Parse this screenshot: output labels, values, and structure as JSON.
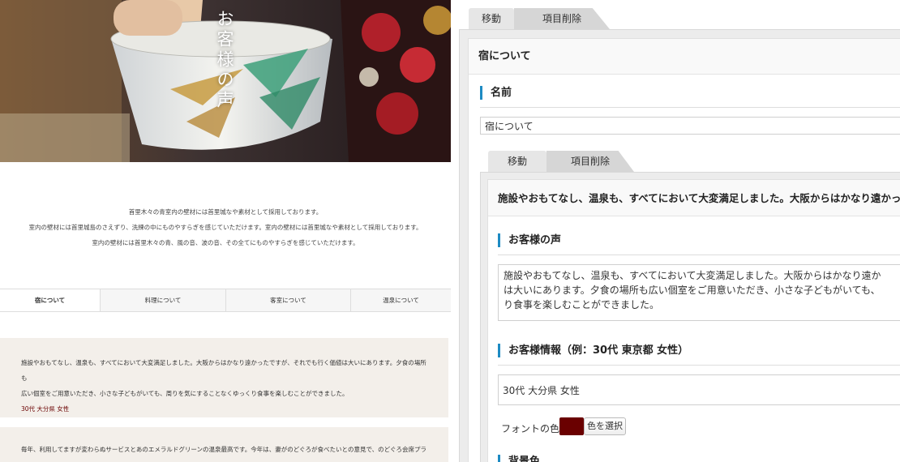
{
  "preview": {
    "hero": {
      "title": "お客様の声"
    },
    "intro": {
      "lines": [
        "首里木々の青室内の壁材には首里城なや素材として採用しております。",
        "室内の壁材には首里城島のさえずり、洗練の中にものやすらぎを感じていただけます。室内の壁材には首里城なや素材として採用しております。",
        "室内の壁材には首里木々の青、風の音、波の音、その全てにものやすらぎを感じていただけます。"
      ]
    },
    "tabs": [
      "宿について",
      "料理について",
      "客室について",
      "温泉について"
    ],
    "reviews": [
      {
        "lines": [
          "施設やおもてなし、温泉も、すべてにおいて大変満足しました。大阪からはかなり遠かったですが、それでも行く価値は大いにあります。夕食の場所も",
          "広い個室をご用意いただき、小さな子どもがいても、周りを気にすることなくゆっくり食事を楽しむことができました。"
        ],
        "meta": "30代 大分県 女性"
      },
      {
        "lines": [
          "毎年、利用してますが変わらぬサービスとあのエメラルドグリーンの温泉最高です。今年は、妻がのどぐろが食べたいとの意見で、のどぐろ会席プラン"
        ]
      }
    ]
  },
  "editor": {
    "outer": {
      "tabs": {
        "move": "移動",
        "delete": "項目削除"
      },
      "header": "宿について",
      "name_label": "名前",
      "name_value": "宿について"
    },
    "inner": {
      "tabs": {
        "move": "移動",
        "delete": "項目削除"
      },
      "header": "施設やおもてなし、温泉も、すべてにおいて大変満足しました。大阪からはかなり遠かっ",
      "voice_label": "お客様の声",
      "voice_text": "施設やおもてなし、温泉も、すべてにおいて大変満足しました。大阪からはかなり遠か\nは大いにあります。夕食の場所も広い個室をご用意いただき、小さな子どもがいても、\nり食事を楽しむことができました。",
      "info_label": "お客様情報（例：30代 東京都 女性）",
      "info_value": "30代 大分県 女性",
      "font_color_label": "フォントの色",
      "font_color": "#6a0000",
      "pick_color_label": "色を選択",
      "bg_label": "背景色"
    }
  },
  "colors": {
    "accent": "#1e8bc3",
    "review_bg": "#f3efea"
  }
}
